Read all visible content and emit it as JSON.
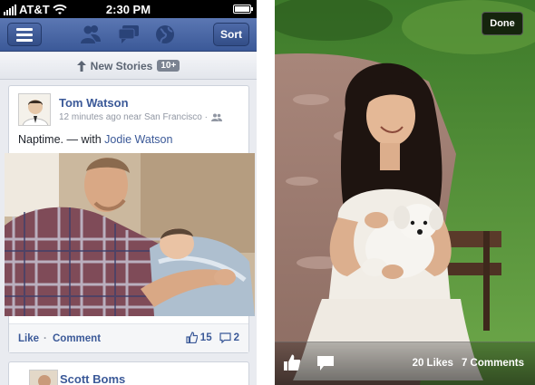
{
  "left_screen": {
    "status_bar": {
      "carrier": "AT&T",
      "time": "2:30 PM"
    },
    "nav_bar": {
      "sort_label": "Sort"
    },
    "new_stories": {
      "label": "New Stories",
      "count": "10+"
    },
    "story": {
      "author": "Tom Watson",
      "meta": "12 minutes ago near San Francisco ·",
      "caption_text": "Naptime. — with ",
      "caption_tag": "Jodie Watson",
      "like_label": "Like",
      "separator": "·",
      "comment_label": "Comment",
      "like_count": "15",
      "comment_count": "2"
    },
    "next_story": {
      "author": "Scott Boms"
    }
  },
  "right_screen": {
    "done_label": "Done",
    "likes_text": "20 Likes",
    "comments_text": "7 Comments"
  },
  "colors": {
    "facebook_blue": "#3b5998",
    "nav_gradient_top": "#5b77b3",
    "meta_gray": "#9197a3"
  },
  "icons": [
    "menu-icon",
    "friends-icon",
    "messages-icon",
    "globe-icon",
    "up-arrow-icon",
    "people-icon",
    "thumbs-up-icon",
    "comment-icon"
  ]
}
